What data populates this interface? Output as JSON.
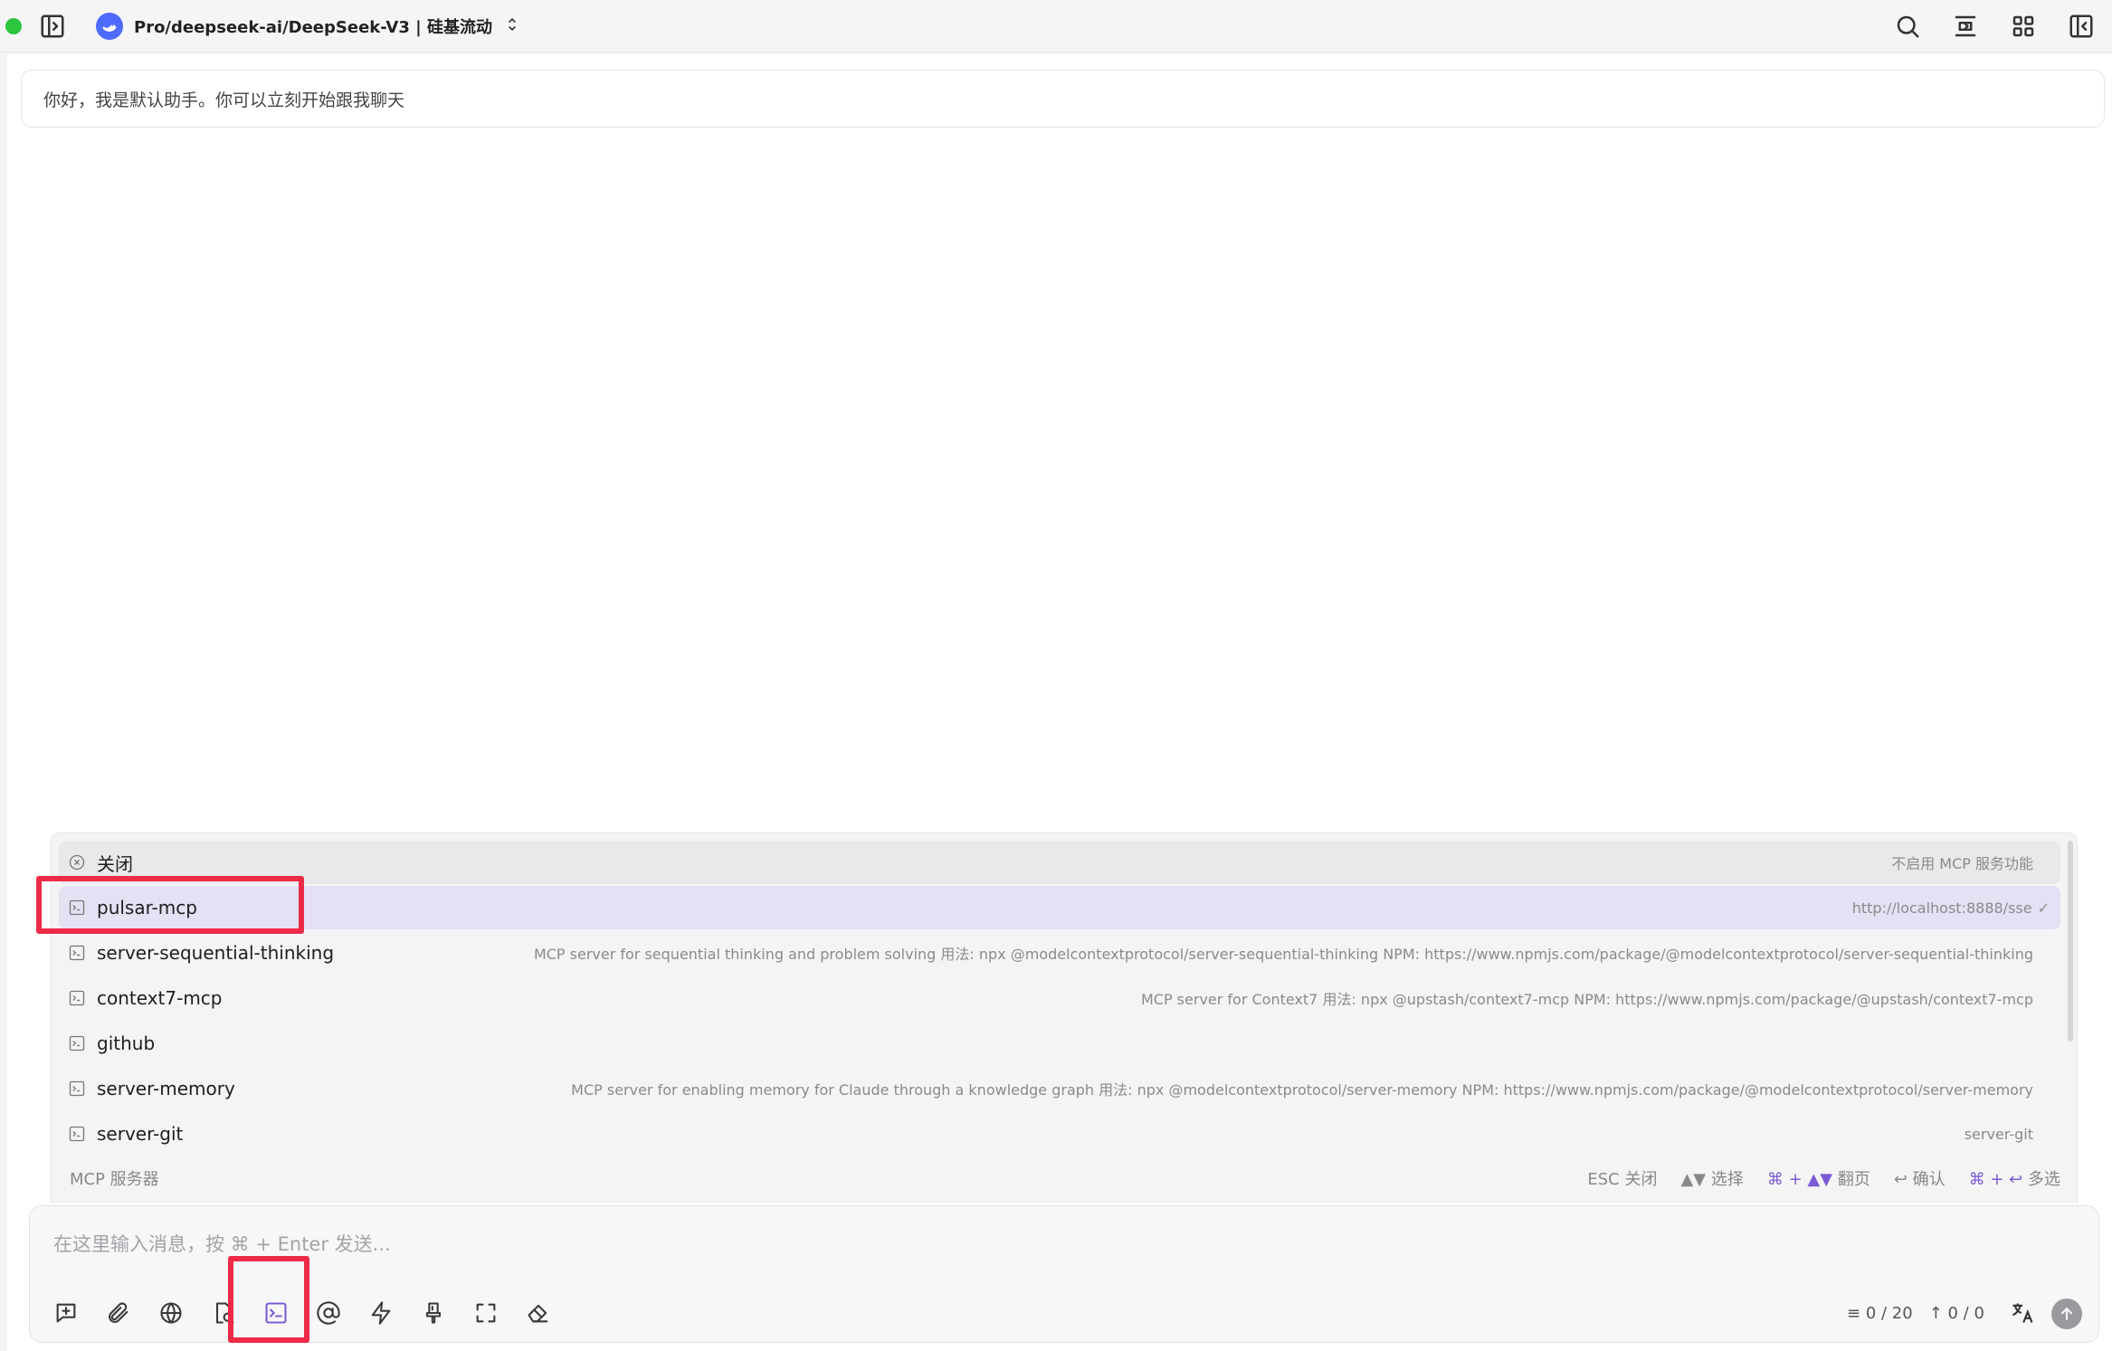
{
  "header": {
    "model_name": "Pro/deepseek-ai/DeepSeek-V3 | 硅基流动",
    "icons": [
      "sidebar-toggle-icon",
      "search-icon",
      "topic-icon",
      "grid-icon",
      "sidebar-right-icon"
    ]
  },
  "chat": {
    "welcome_message": "你好，我是默认助手。你可以立刻开始跟我聊天"
  },
  "mcp_popup": {
    "close_label": "关闭",
    "close_desc": "不启用 MCP 服务功能",
    "servers": [
      {
        "name": "pulsar-mcp",
        "desc": "http://localhost:8888/sse",
        "selected": true
      },
      {
        "name": "server-sequential-thinking",
        "desc": "MCP server for sequential thinking and problem solving 用法: npx @modelcontextprotocol/server-sequential-thinking NPM: https://www.npmjs.com/package/@modelcontextprotocol/server-sequential-thinking",
        "selected": false
      },
      {
        "name": "context7-mcp",
        "desc": "MCP server for Context7 用法: npx @upstash/context7-mcp NPM: https://www.npmjs.com/package/@upstash/context7-mcp",
        "selected": false
      },
      {
        "name": "github",
        "desc": "",
        "selected": false
      },
      {
        "name": "server-memory",
        "desc": "MCP server for enabling memory for Claude through a knowledge graph 用法: npx @modelcontextprotocol/server-memory NPM: https://www.npmjs.com/package/@modelcontextprotocol/server-memory",
        "selected": false
      },
      {
        "name": "server-git",
        "desc": "server-git",
        "selected": false
      }
    ],
    "footer_title": "MCP 服务器",
    "hints": {
      "esc": "ESC 关闭",
      "select": "▲▼ 选择",
      "page_key": "⌘ + ▲▼",
      "page": "翻页",
      "confirm": "↩ 确认",
      "multi_key": "⌘ + ↩",
      "multi": "多选"
    }
  },
  "input": {
    "placeholder": "在这里输入消息，按 ⌘ + Enter 发送...",
    "context_count": "0 / 20",
    "token_count": "0 / 0"
  },
  "colors": {
    "accent": "#7b5bd6",
    "highlight": "#ee2b47",
    "selected_row": "#e6e0f4"
  }
}
